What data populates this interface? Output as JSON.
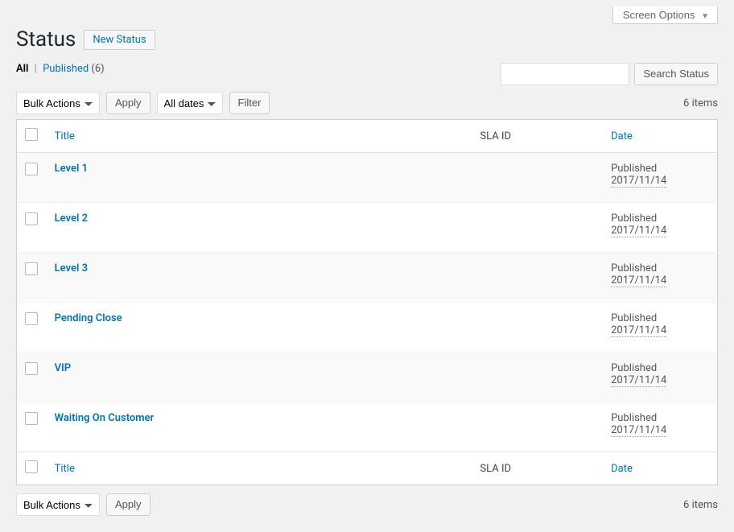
{
  "screen_options_label": "Screen Options",
  "page_title": "Status",
  "new_button_label": "New Status",
  "filters": {
    "all_label": "All",
    "published_label": "Published",
    "published_count": "(6)"
  },
  "search": {
    "button_label": "Search Status",
    "value": ""
  },
  "bulk_actions": {
    "placeholder": "Bulk Actions",
    "apply_label": "Apply"
  },
  "date_filter": {
    "placeholder": "All dates",
    "filter_label": "Filter"
  },
  "item_count_label": "6 items",
  "columns": {
    "title": "Title",
    "sla_id": "SLA ID",
    "date": "Date"
  },
  "rows": [
    {
      "title": "Level 1",
      "sla_id": "",
      "status": "Published",
      "date": "2017/11/14"
    },
    {
      "title": "Level 2",
      "sla_id": "",
      "status": "Published",
      "date": "2017/11/14"
    },
    {
      "title": "Level 3",
      "sla_id": "",
      "status": "Published",
      "date": "2017/11/14"
    },
    {
      "title": "Pending Close",
      "sla_id": "",
      "status": "Published",
      "date": "2017/11/14"
    },
    {
      "title": "VIP",
      "sla_id": "",
      "status": "Published",
      "date": "2017/11/14"
    },
    {
      "title": "Waiting On Customer",
      "sla_id": "",
      "status": "Published",
      "date": "2017/11/14"
    }
  ]
}
